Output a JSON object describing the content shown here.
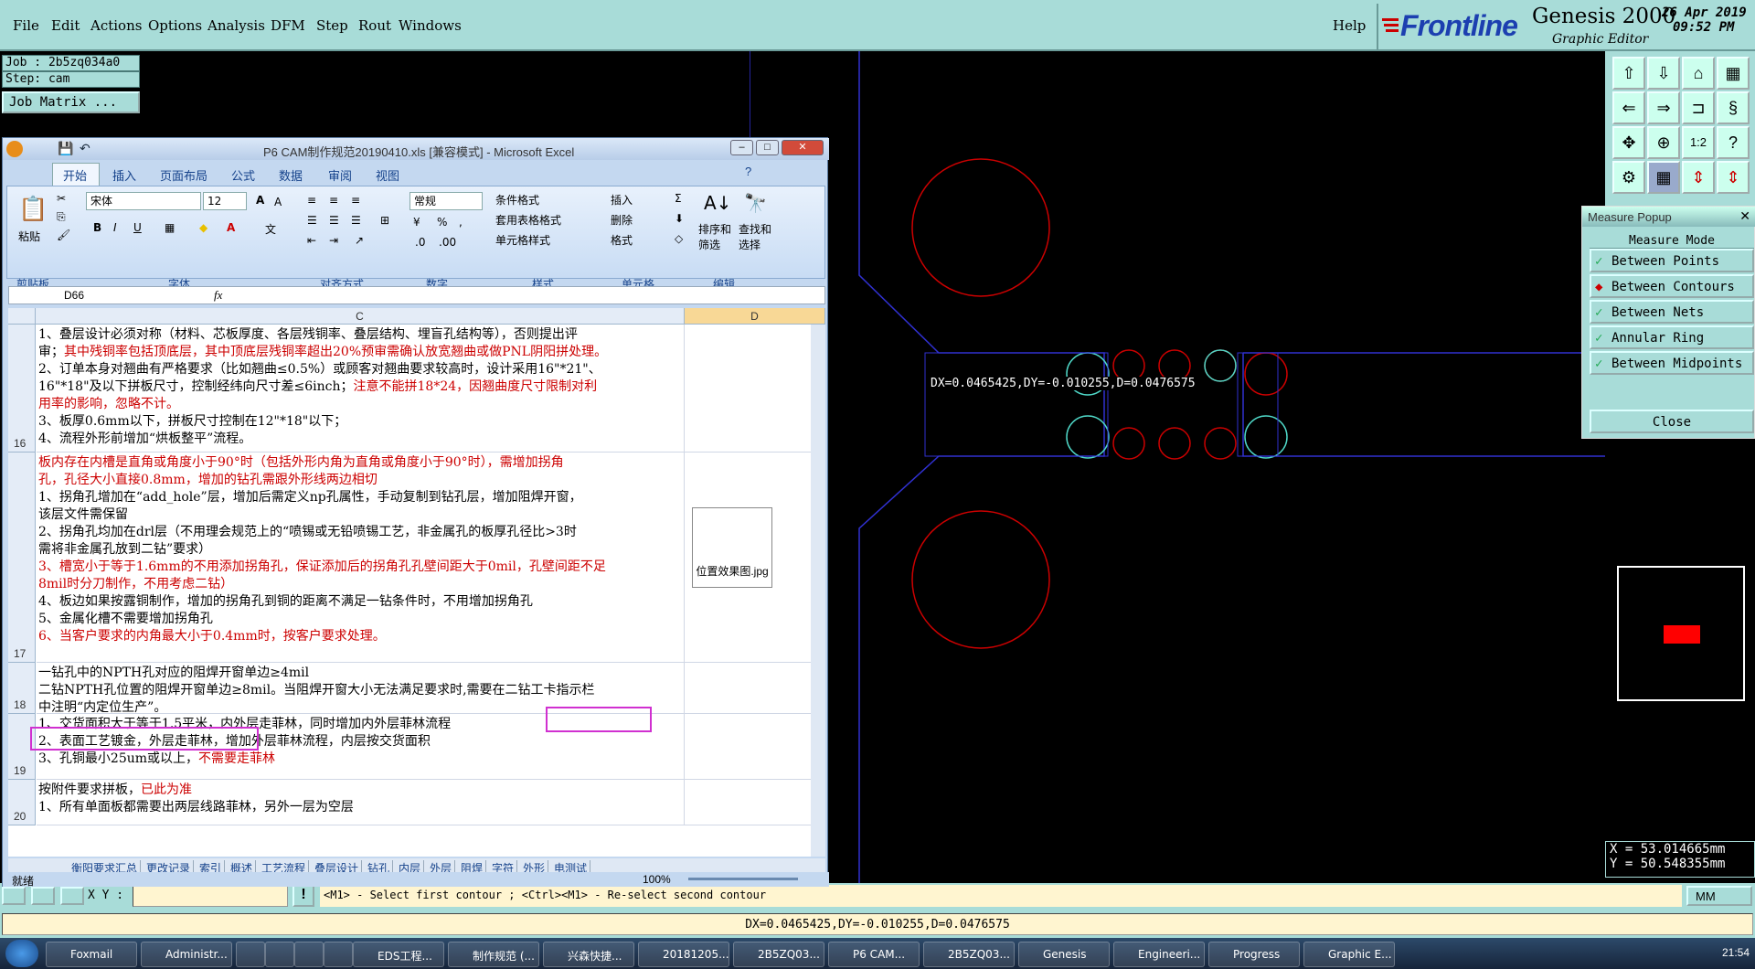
{
  "menu": {
    "items": [
      "File",
      "Edit",
      "Actions",
      "Options",
      "Analysis",
      "DFM",
      "Step",
      "Rout",
      "Windows"
    ],
    "help": "Help"
  },
  "brand": {
    "frontline": "Frontline",
    "genesis": "Genesis 2000",
    "editor": "Graphic Editor",
    "date": "26 Apr 2019",
    "time": "09:52 PM"
  },
  "job": {
    "job": "Job : 2b5zq034a0",
    "step": "Step: cam",
    "matrix": "Job Matrix ..."
  },
  "excel": {
    "title": "P6 CAM制作规范20190410.xls [兼容模式] - Microsoft Excel",
    "tabs": [
      "开始",
      "插入",
      "页面布局",
      "公式",
      "数据",
      "审阅",
      "视图"
    ],
    "groups": [
      "剪贴板",
      "字体",
      "对齐方式",
      "数字",
      "样式",
      "单元格",
      "编辑"
    ],
    "ribbon": {
      "paste": "粘贴",
      "font": "宋体",
      "size": "12",
      "format": "常规",
      "cond": "条件格式",
      "table": "套用表格格式",
      "cellstyle": "单元格样式",
      "insert": "插入",
      "delete": "删除",
      "fmt": "格式",
      "sort": "排序和筛选",
      "find": "查找和选择"
    },
    "namebox": "D66",
    "colC": "C",
    "colD": "D",
    "rows": [
      {
        "num": "16",
        "lines": [
          [
            "1、叠层设计必须对称（材料、芯板厚度、各层残铜率、叠层结构、埋盲孔结构等），否则提出评",
            ""
          ],
          [
            "审；",
            "其中残铜率包括顶底层，其中顶底层残铜率超出20%预审需确认放宽翘曲或做PNL阴阳拼处理。"
          ],
          [
            "2、订单本身对翘曲有严格要求（比如翘曲≤0.5%）或顾客对翘曲要求较高时，设计采用16\"*21\"、",
            ""
          ],
          [
            "16\"*18\"及以下拼板尺寸，控制经纬向尺寸差≤6inch；",
            "注意不能拼18*24，因翘曲度尺寸限制对利"
          ],
          [
            "",
            "用率的影响，忽略不计。"
          ],
          [
            "3、板厚0.6mm以下，拼板尺寸控制在12\"*18\"以下；",
            ""
          ],
          [
            "4、流程外形前增加“烘板整平”流程。",
            ""
          ]
        ]
      },
      {
        "num": "17",
        "lines": [
          [
            "",
            "板内存在内槽是直角或角度小于90°时（包括外形内角为直角或角度小于90°时），需增加拐角"
          ],
          [
            "",
            "孔，孔径大小直接0.8mm，增加的钻孔需跟外形线两边相切"
          ],
          [
            "1、拐角孔增加在“add_hole”层，增加后需定义np孔属性，手动复制到钻孔层，增加阻焊开窗，",
            ""
          ],
          [
            "该层文件需保留",
            ""
          ],
          [
            "2、拐角孔均加在drl层（不用理会规范上的“喷锡或无铅喷锡工艺，非金属孔的板厚孔径比>3时",
            ""
          ],
          [
            "需将非金属孔放到二钻”要求）",
            ""
          ],
          [
            "",
            "3、槽宽小于等于1.6mm的不用添加拐角孔，保证添加后的拐角孔孔壁间距大于0mil，孔壁间距不足"
          ],
          [
            "",
            "8mil时分刀制作，不用考虑二钻）"
          ],
          [
            "4、板边如果按露铜制作，增加的拐角孔到铜的距离不满足一钻条件时，不用增加拐角孔",
            ""
          ],
          [
            "5、金属化槽不需要增加拐角孔",
            ""
          ],
          [
            "",
            "6、当客户要求的内角最大小于0.4mm时，按客户要求处理。"
          ]
        ],
        "img": "位置效果图.jpg"
      },
      {
        "num": "18",
        "lines": [
          [
            "一钻孔中的NPTH孔对应的阻焊开窗单边≥4mil",
            ""
          ],
          [
            "二钻NPTH孔位置的阻焊开窗单边≥8mil。当阻焊开窗大小无法满足要求时,需要在二钻工卡指示栏",
            ""
          ],
          [
            "中注明“内定位生产”。",
            ""
          ]
        ]
      },
      {
        "num": "19",
        "lines": [
          [
            "1、交货面积大于等于1.5平米，内外层走菲林，同时增加内外层菲林流程",
            ""
          ],
          [
            "2、表面工艺镀金，外层走菲林，增加外层菲林流程，内层按交货面积",
            ""
          ],
          [
            "3、孔铜最小25um或以上，",
            "不需要走菲林"
          ]
        ]
      },
      {
        "num": "20",
        "lines": [
          [
            "按附件要求拼板，",
            "已此为准"
          ],
          [
            "1、所有单面板都需要出两层线路菲林，另外一层为空层",
            ""
          ]
        ]
      }
    ],
    "sheets": [
      "衡阳要求汇总",
      "更改记录",
      "索引",
      "概述",
      "工艺流程",
      "叠层设计",
      "钻孔",
      "内层",
      "外层",
      "阻焊",
      "字符",
      "外形",
      "电测试"
    ],
    "status": "就绪",
    "zoom": "100%"
  },
  "cad": {
    "measure": "DX=0.0465425,DY=-0.010255,D=0.0476575",
    "x": "X = 53.014665mm",
    "y": "Y = 50.548355mm"
  },
  "popup": {
    "title": "Measure Popup",
    "mode": "Measure Mode",
    "options": [
      "Between Points",
      "Between Contours",
      "Between Nets",
      "Annular Ring",
      "Between Midpoints"
    ],
    "close": "Close"
  },
  "statusbar": {
    "xy": "X Y :",
    "prompt": "<M1> - Select first contour ; <Ctrl><M1> - Re-select second contour",
    "units": "MM",
    "result": "DX=0.0465425,DY=-0.010255,D=0.0476575"
  },
  "taskbar": {
    "items": [
      "Foxmail",
      "Administr...",
      "",
      "",
      "",
      "",
      "EDS工程...",
      "制作规范 (...",
      "兴森快捷...",
      "20181205...",
      "2B5ZQ03...",
      "P6 CAM...",
      "2B5ZQ03...",
      "Genesis",
      "Engineeri...",
      "Progress",
      "Graphic E..."
    ],
    "time": "21:54"
  },
  "colors": {
    "panel": "#a8dcd8",
    "red": "#cc0000",
    "cyan": "#4fd8c8",
    "blue": "#3030d0"
  }
}
